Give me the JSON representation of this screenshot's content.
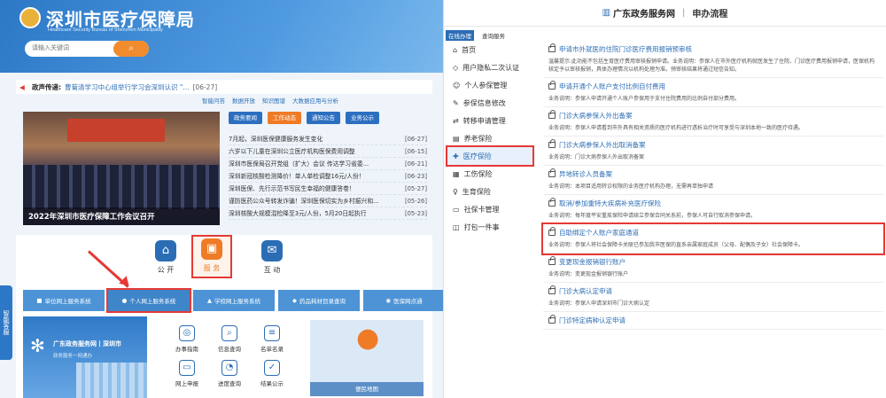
{
  "left": {
    "site_title": "深圳市医疗保障局",
    "site_subtitle": "Healthcare Security Bureau of Shenzhen Municipality",
    "search_placeholder": "请输入关键词",
    "ticker": {
      "label": "政声传递:",
      "text": "曹菊清学习中心组举行学习会深圳认识 \"...",
      "date": "[06-27]"
    },
    "toolbar": [
      "智能问答",
      "数据开放",
      "知识图谱",
      "大数据应用与分析"
    ],
    "photo_caption": "2022年深圳市医疗保障工作会议召开",
    "tabs": [
      "政务要闻",
      "工作动态",
      "通知公告",
      "业务公示"
    ],
    "news": [
      {
        "title": "7月起，深圳医保健康服务发生变化",
        "date": "[06-27]"
      },
      {
        "title": "六岁以下儿童在深圳公立医疗机构医保费用调整",
        "date": "[06-15]"
      },
      {
        "title": "深圳市医保局召开党组（扩大）会议 传达学习省委...",
        "date": "[06-21]"
      },
      {
        "title": "深圳新冠核酸检测降价！单人单检调整16元/人份！",
        "date": "[06-23]"
      },
      {
        "title": "深圳医保、先行示范书写民生幸福的健康答卷！",
        "date": "[05-27]"
      },
      {
        "title": "谨防医药公众号转发诈骗！深圳医保切实为乡村振兴和...",
        "date": "[05-26]"
      },
      {
        "title": "深圳核酸大规模混检降至3元/人份，5月20日起执行",
        "date": "[05-23]"
      }
    ],
    "service_icons": [
      {
        "label": "公 开",
        "icon": "building-icon"
      },
      {
        "label": "服 务",
        "icon": "service-box-icon"
      },
      {
        "label": "互 动",
        "icon": "chat-icon"
      }
    ],
    "service_buttons": [
      "单位网上服务系统",
      "个人网上服务系统",
      "学校网上服务系统",
      "药品耗材目录查询",
      "医保网点通"
    ],
    "banner_title": "广东政务服务网丨深圳市",
    "banner_subtitle": "政务服务一网通办",
    "grid_items": [
      "办事指南",
      "信息查询",
      "名单名录",
      "网上申报",
      "进度查询",
      "结果公示"
    ],
    "map_caption": "便民地图",
    "side_tab": "智能客服"
  },
  "right": {
    "brand": "广东政务服务网",
    "process": "申办流程",
    "tabs": [
      "在线办理",
      "查询服务"
    ],
    "menu": [
      "首页",
      "用户隐私二次认证",
      "个人参保管理",
      "参保信息修改",
      "转移申请管理",
      "养老保险",
      "医疗保险",
      "工伤保险",
      "生育保险",
      "社保卡管理",
      "打包一件事"
    ],
    "items": [
      {
        "title": "申请市外就医的住院门诊医疗费用报销预审核",
        "desc": "温馨提示:此功能不包括生育医疗费用审核报销申请。业务说明：参保人在市外医疗机构就医发生了住院、门诊医疗费用报销申请，医保机构核定予以审核报销，具体办理情况以机构处理为准。预审核结果将通过短信告知。"
      },
      {
        "title": "申请开通个人账户支付比例自付费用",
        "desc": "业务说明：参保人申请开通个人账户参保用于支付住院费用的比例自付部分费用。"
      },
      {
        "title": "门诊大病参保人外出备案",
        "desc": "业务说明：参保人申请看到市外具有相关资质的医疗机构进行透析治疗时可享受与深圳本地一致的医疗待遇。"
      },
      {
        "title": "门诊大病参保人外出取消备案",
        "desc": "业务说明：门诊大病参保人外出取消备案"
      },
      {
        "title": "异地转诊人员备案",
        "desc": "业务说明：本项目适用转诊权限的业务医疗机构办理，无需再单独申请"
      },
      {
        "title": "取消/参加重特大疾病补充医疗保险",
        "desc": "业务说明：每年度平安重疾保险申请续立参保合同关系前，参保人可自行取消参保申请。"
      },
      {
        "title": "自助绑定个人账户家庭通道",
        "desc": "业务说明：参保人将社会保障卡关联已参加我市医保的直系亲属家庭成员（父母、配偶及子女）社会保障卡。"
      },
      {
        "title": "变更现金报销银行账户",
        "desc": "业务说明：变更现金报销银行账户"
      },
      {
        "title": "门诊大病认定申请",
        "desc": "业务说明：参保人申请深圳市门诊大病认定"
      },
      {
        "title": "门诊特定病种认定申请",
        "desc": ""
      }
    ]
  }
}
